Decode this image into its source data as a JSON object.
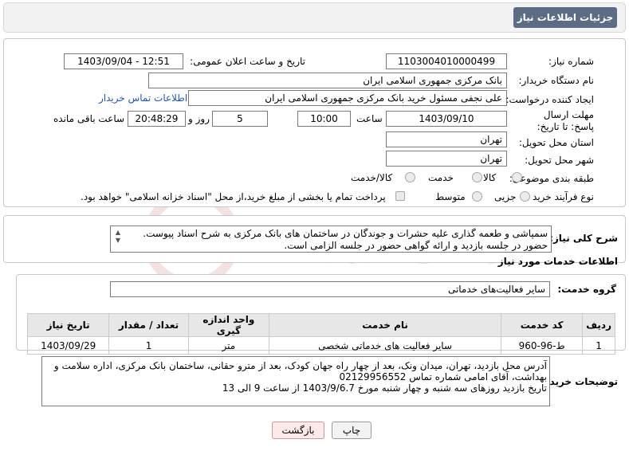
{
  "header": {
    "title": "جزئیات اطلاعات نیاز"
  },
  "form": {
    "need_number": {
      "label": "شماره نیاز:",
      "value": "1103004010000499"
    },
    "announce_datetime": {
      "label": "تاریخ و ساعت اعلان عمومی:",
      "value": "1403/09/04 - 12:51"
    },
    "buyer_org": {
      "label": "نام دستگاه خریدار:",
      "value": "بانک مرکزی جمهوری اسلامی ایران"
    },
    "requester": {
      "label": "ایجاد کننده درخواست:",
      "value": "علی  نجفی مسئول خرید بانک مرکزی جمهوری اسلامی ایران",
      "contact_link": "اطلاعات تماس خریدار"
    },
    "deadline": {
      "label": "مهلت ارسال پاسخ: تا تاریخ:",
      "date": "1403/09/10",
      "time_label": "ساعت",
      "time": "10:00",
      "days": "5",
      "days_label": "روز و",
      "remaining": "20:48:29",
      "remaining_label": "ساعت باقی مانده"
    },
    "province": {
      "label": "استان محل تحویل:",
      "value": "تهران"
    },
    "city": {
      "label": "شهر محل تحویل:",
      "value": "تهران"
    },
    "category": {
      "label": "طبقه بندی موضوعی:",
      "options": [
        "کالا",
        "خدمت",
        "کالا/خدمت"
      ]
    },
    "process": {
      "label": "نوع فرآیند خرید :",
      "options": [
        "جزیی",
        "متوسط"
      ],
      "payment_note": "پرداخت تمام یا بخشی از مبلغ خرید،از محل \"اسناد خزانه اسلامی\" خواهد بود."
    }
  },
  "description": {
    "label": "شرح کلی نیاز:",
    "line1": "سمپاشی و طعمه گذاری علیه حشرات و جوندگان در ساختمان های بانک مرکزی به شرح اسناد پیوست.",
    "line2": "حضور در جلسه بازدید و ارائه گواهی حضور در جلسه الزامی است."
  },
  "services": {
    "section_title": "اطلاعات خدمات مورد نیاز",
    "group_label": "گروه خدمت:",
    "group_value": "سایر فعالیت‌های خدماتی",
    "columns": [
      "ردیف",
      "کد خدمت",
      "نام خدمت",
      "واحد اندازه گیری",
      "تعداد / مقدار",
      "تاریخ نیاز"
    ],
    "rows": [
      {
        "row": "1",
        "code": "ط-96-960",
        "name": "سایر فعالیت های خدماتی شخصی",
        "unit": "متر",
        "qty": "1",
        "date": "1403/09/29"
      }
    ]
  },
  "buyer_notes": {
    "label": "توضیحات خریدار:",
    "line1": "آدرس محل بازدید، تهران، میدان ونک، بعد از چهار راه جهان کودک، بعد از مترو حقانی، ساختمان بانک مرکزی، اداره سلامت و",
    "line2": "بهداشت، آقای امامی شماره تماس 02129956552",
    "line3": "تاریخ بازدید روزهای سه شنبه و چهار شنبه مورخ 1403/9/6.7 از ساعت 9 الی 13"
  },
  "buttons": {
    "print": "چاپ",
    "back": "بازگشت"
  },
  "watermark": {
    "text": "AriaTender.net"
  },
  "colors": {
    "header_bg": "#5b6c84",
    "link": "#2456a8",
    "back_button_bg": "#fde9ea"
  }
}
